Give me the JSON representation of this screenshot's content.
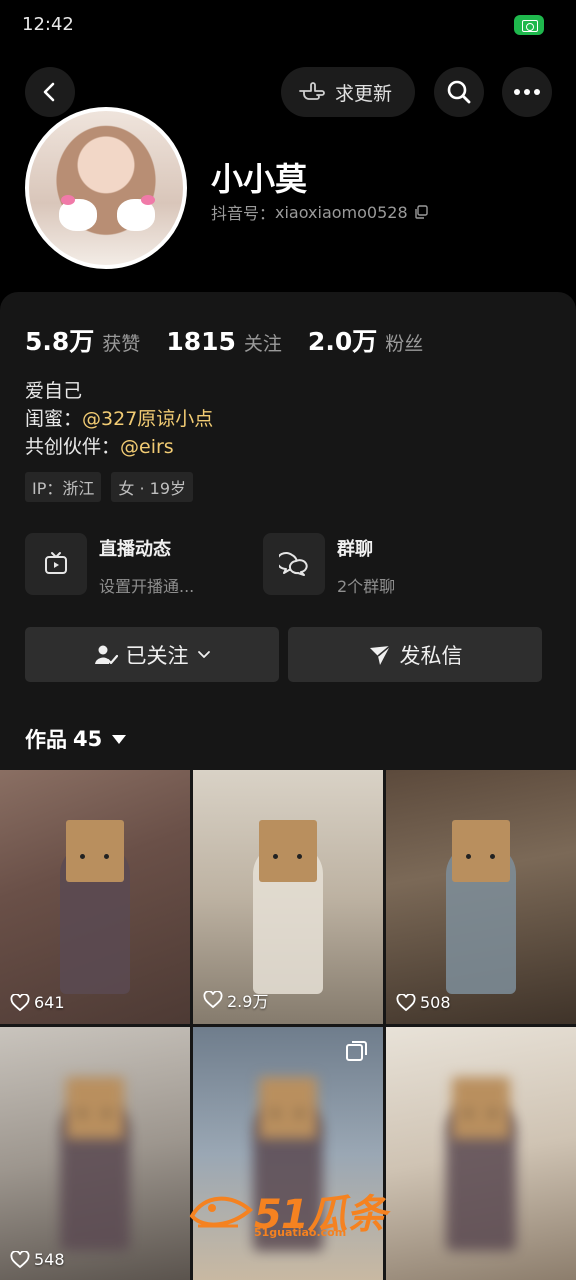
{
  "status_bar": {
    "time": "12:42"
  },
  "header": {
    "update_label": "求更新"
  },
  "profile": {
    "name": "小小莫",
    "id_label": "抖音号：",
    "id_value": "xiaoxiaomo0528"
  },
  "stats": [
    {
      "value": "5.8万",
      "label": "获赞"
    },
    {
      "value": "1815",
      "label": "关注"
    },
    {
      "value": "2.0万",
      "label": "粉丝"
    }
  ],
  "bio": {
    "line1": "爱自己",
    "line2_prefix": "闺蜜：",
    "line2_mention": "@327原谅小点",
    "line3_prefix": "共创伙伴：",
    "line3_mention": "@eirs"
  },
  "tags": [
    "IP：浙江",
    "女 · 19岁"
  ],
  "features": {
    "live": {
      "title": "直播动态",
      "subtitle": "设置开播通..."
    },
    "group": {
      "title": "群聊",
      "subtitle": "2个群聊"
    }
  },
  "actions": {
    "follow": "已关注",
    "message": "发私信"
  },
  "works": {
    "label": "作品",
    "count": "45",
    "items": [
      {
        "likes": "641"
      },
      {
        "likes": "2.9万"
      },
      {
        "likes": "508"
      },
      {
        "likes": "548"
      },
      {
        "likes": ""
      },
      {
        "likes": ""
      }
    ]
  },
  "watermark": {
    "text": "51瓜条",
    "url": "51guatiao.com"
  },
  "colors": {
    "accent_mention": "#f2cc74",
    "status_camera": "#1fb84d",
    "watermark": "#f58220"
  }
}
